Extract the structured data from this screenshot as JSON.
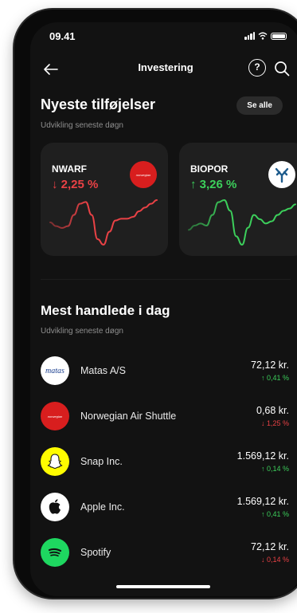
{
  "status": {
    "time": "09.41"
  },
  "header": {
    "title": "Investering",
    "help_glyph": "?"
  },
  "newest": {
    "title": "Nyeste tilføjelser",
    "subtitle": "Udvikling seneste døgn",
    "see_all": "Se alle",
    "cards": [
      {
        "ticker": "NWARF",
        "change": "↓ 2,25 %",
        "direction": "down",
        "logo_text": "norwegian",
        "logo_color": "#d81e1e",
        "sparkline": [
          30,
          34,
          36,
          34,
          22,
          10,
          8,
          22,
          48,
          54,
          40,
          28,
          26,
          26,
          24,
          18,
          14,
          10,
          6
        ]
      },
      {
        "ticker": "BIOPOR",
        "change": "↑ 3,26 %",
        "direction": "up",
        "logo_text": "",
        "logo_color": "#ffffff",
        "sparkline": [
          30,
          26,
          24,
          26,
          16,
          4,
          2,
          12,
          36,
          44,
          28,
          16,
          20,
          24,
          22,
          16,
          12,
          10,
          6
        ]
      }
    ]
  },
  "most_traded": {
    "title": "Mest handlede i dag",
    "subtitle": "Udvikling seneste døgn",
    "items": [
      {
        "name": "Matas A/S",
        "price": "72,12 kr.",
        "pct": "↑ 0,41 %",
        "direction": "up",
        "logo": "matas",
        "logo_text": "matas"
      },
      {
        "name": "Norwegian Air Shuttle",
        "price": "0,68 kr.",
        "pct": "↓ 1,25 %",
        "direction": "down",
        "logo": "norwegian",
        "logo_text": "norwegian"
      },
      {
        "name": "Snap Inc.",
        "price": "1.569,12 kr.",
        "pct": "↑ 0,14 %",
        "direction": "up",
        "logo": "snap",
        "logo_text": ""
      },
      {
        "name": "Apple Inc.",
        "price": "1.569,12 kr.",
        "pct": "↑ 0,41 %",
        "direction": "up",
        "logo": "apple",
        "logo_text": ""
      },
      {
        "name": "Spotify",
        "price": "72,12 kr.",
        "pct": "↓ 0,14 %",
        "direction": "down",
        "logo": "spotify",
        "logo_text": ""
      }
    ]
  },
  "colors": {
    "up": "#3ccf5b",
    "down": "#e94145",
    "card": "#1f1f1f",
    "screen": "#121212"
  }
}
